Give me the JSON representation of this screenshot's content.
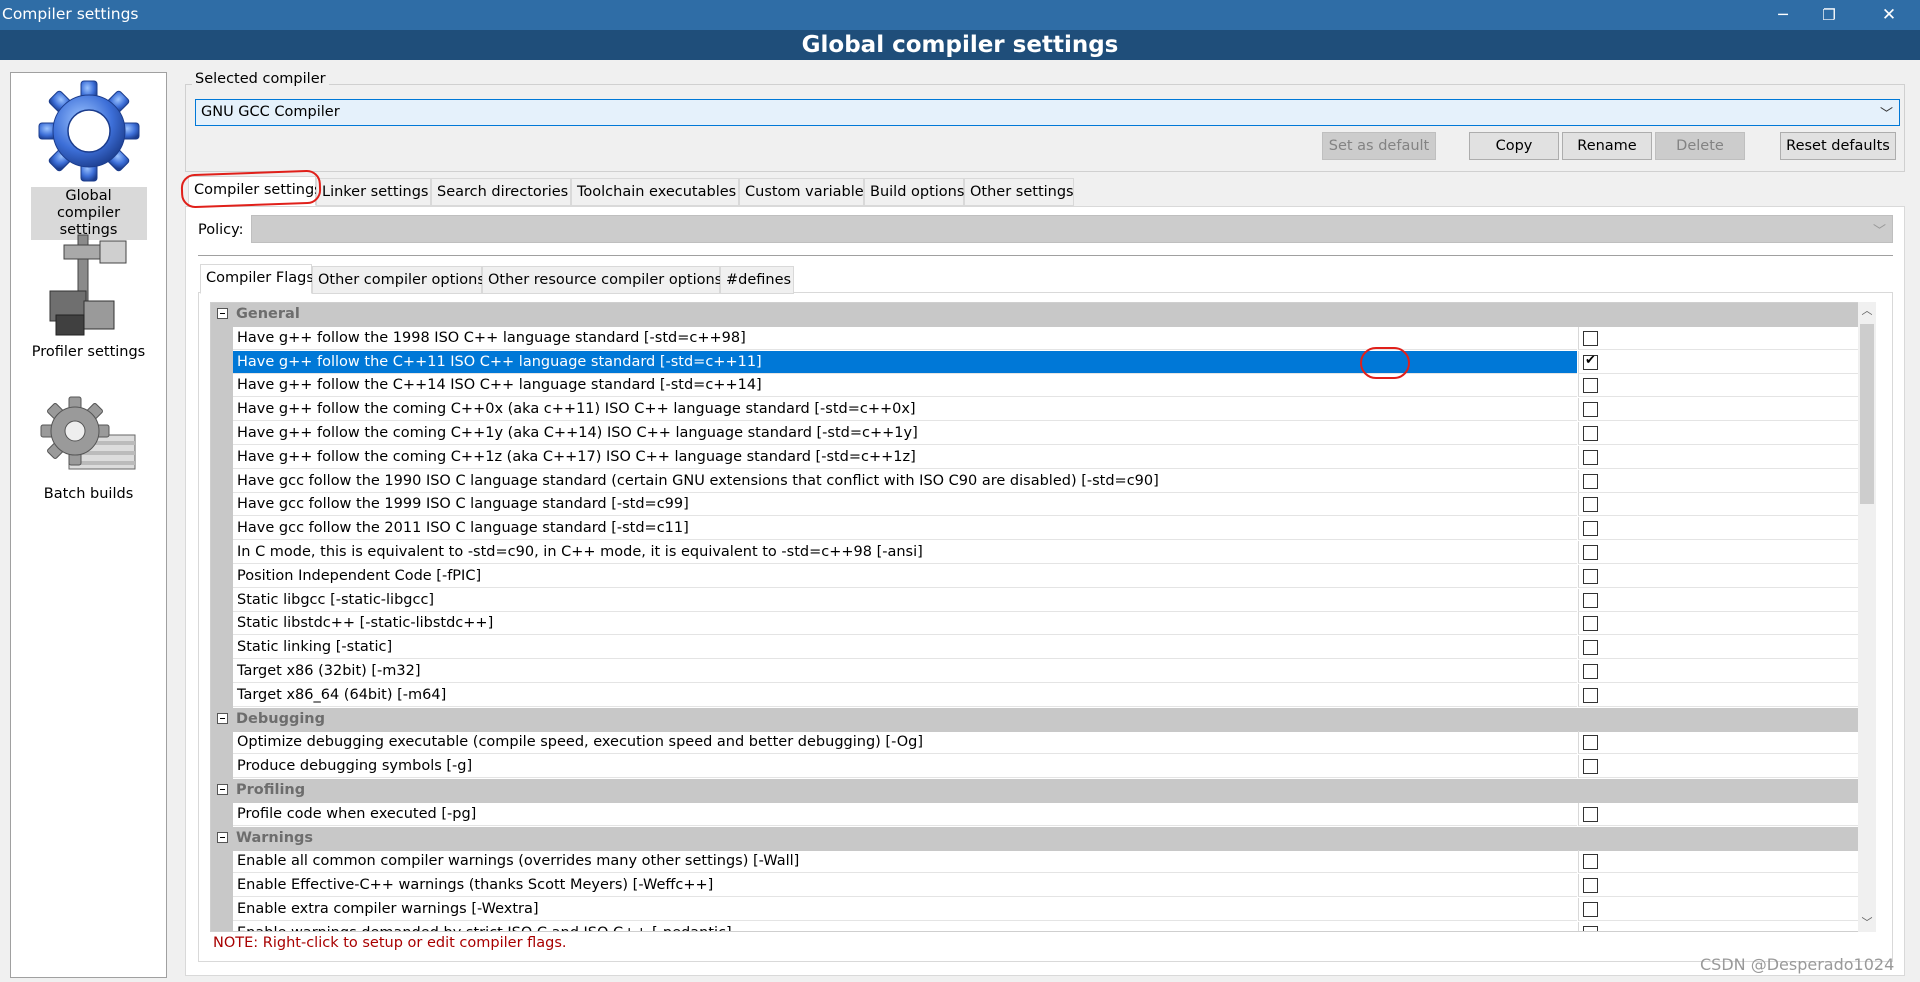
{
  "window": {
    "title": "Compiler settings",
    "banner": "Global compiler settings",
    "controls": [
      "─",
      "❐",
      "✕"
    ]
  },
  "sidebar": {
    "items": [
      {
        "label": "Global compiler settings",
        "icon": "gear-icon",
        "selected": true
      },
      {
        "label": "Profiler settings",
        "icon": "caliper-icon",
        "selected": false
      },
      {
        "label": "Batch builds",
        "icon": "batch-gear-icon",
        "selected": false
      }
    ]
  },
  "selected_compiler": {
    "legend": "Selected compiler",
    "value": "GNU GCC Compiler"
  },
  "buttons": {
    "set_default": "Set as default",
    "copy": "Copy",
    "rename": "Rename",
    "delete": "Delete",
    "reset_defaults": "Reset defaults"
  },
  "main_tabs": [
    "Compiler settings",
    "Linker settings",
    "Search directories",
    "Toolchain executables",
    "Custom variables",
    "Build options",
    "Other settings"
  ],
  "policy": {
    "label": "Policy:",
    "value": ""
  },
  "sub_tabs": [
    "Compiler Flags",
    "Other compiler options",
    "Other resource compiler options",
    "#defines"
  ],
  "flags": {
    "categories": [
      {
        "name": "General",
        "items": [
          {
            "label": "Have g++ follow the 1998 ISO C++ language standard  [-std=c++98]",
            "checked": false
          },
          {
            "label": "Have g++ follow the C++11 ISO C++ language standard  [-std=c++11]",
            "checked": true,
            "selected": true
          },
          {
            "label": "Have g++ follow the C++14 ISO C++ language standard  [-std=c++14]",
            "checked": false
          },
          {
            "label": "Have g++ follow the coming C++0x (aka c++11) ISO C++ language standard  [-std=c++0x]",
            "checked": false
          },
          {
            "label": "Have g++ follow the coming C++1y (aka C++14) ISO C++ language standard  [-std=c++1y]",
            "checked": false
          },
          {
            "label": "Have g++ follow the coming C++1z (aka C++17) ISO C++ language standard  [-std=c++1z]",
            "checked": false
          },
          {
            "label": "Have gcc follow the 1990 ISO C language standard  (certain GNU extensions that conflict with ISO C90 are disabled)  [-std=c90]",
            "checked": false
          },
          {
            "label": "Have gcc follow the 1999 ISO C language standard  [-std=c99]",
            "checked": false
          },
          {
            "label": "Have gcc follow the 2011 ISO C language standard  [-std=c11]",
            "checked": false
          },
          {
            "label": "In C mode, this is equivalent to -std=c90, in C++ mode, it is equivalent to -std=c++98  [-ansi]",
            "checked": false
          },
          {
            "label": "Position Independent Code  [-fPIC]",
            "checked": false
          },
          {
            "label": "Static libgcc  [-static-libgcc]",
            "checked": false
          },
          {
            "label": "Static libstdc++  [-static-libstdc++]",
            "checked": false
          },
          {
            "label": "Static linking  [-static]",
            "checked": false
          },
          {
            "label": "Target x86 (32bit)  [-m32]",
            "checked": false
          },
          {
            "label": "Target x86_64 (64bit)  [-m64]",
            "checked": false
          }
        ]
      },
      {
        "name": "Debugging",
        "items": [
          {
            "label": "Optimize debugging executable (compile speed, execution speed and better debugging)  [-Og]",
            "checked": false
          },
          {
            "label": "Produce debugging symbols  [-g]",
            "checked": false
          }
        ]
      },
      {
        "name": "Profiling",
        "items": [
          {
            "label": "Profile code when executed  [-pg]",
            "checked": false
          }
        ]
      },
      {
        "name": "Warnings",
        "items": [
          {
            "label": "Enable all common compiler warnings (overrides many other settings)  [-Wall]",
            "checked": false
          },
          {
            "label": "Enable Effective-C++ warnings (thanks Scott Meyers)  [-Weffc++]",
            "checked": false
          },
          {
            "label": "Enable extra compiler warnings  [-Wextra]",
            "checked": false
          },
          {
            "label": "Enable warnings demanded by strict ISO C and ISO C++  [-pedantic]",
            "checked": false
          }
        ]
      }
    ]
  },
  "note": "NOTE: Right-click to setup or edit compiler flags.",
  "watermark": "CSDN @Desperado1024",
  "colors": {
    "titlebar": "#2f6da6",
    "banner": "#1f4e7a",
    "selection": "#0078d7",
    "category": "#c8c8c8",
    "annotation": "#e0201a",
    "note": "#a80000"
  }
}
